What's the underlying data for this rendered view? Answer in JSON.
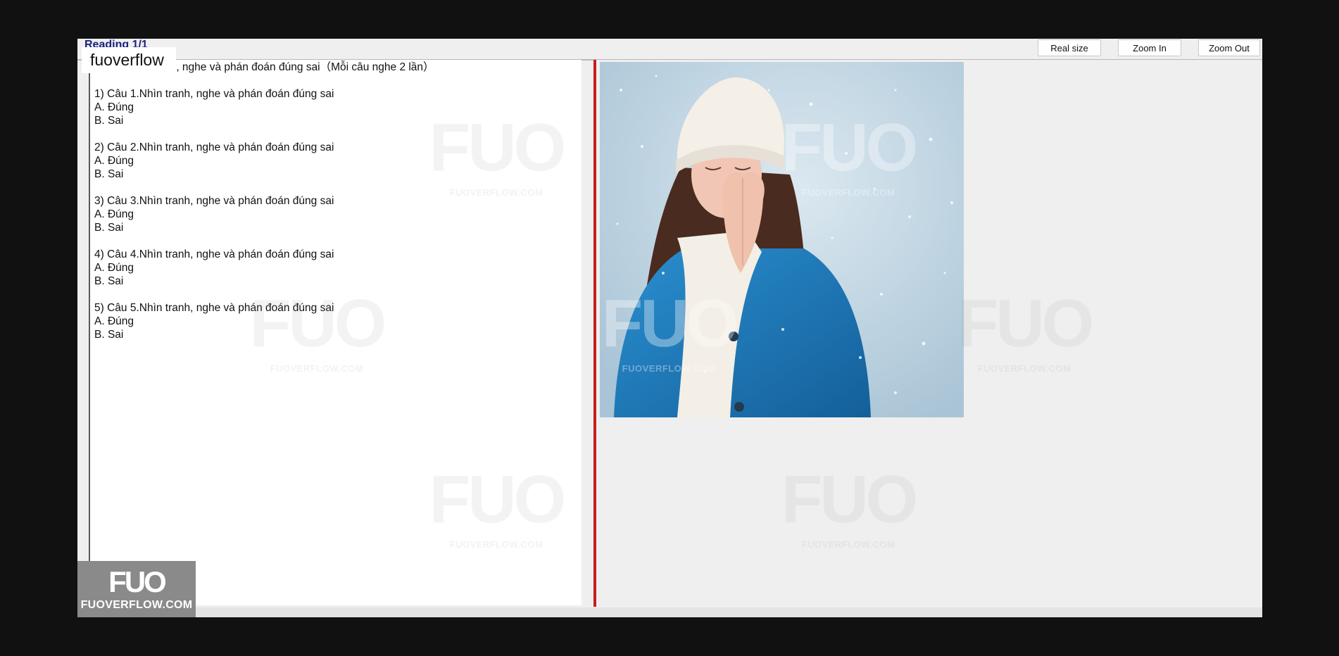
{
  "app": {
    "title": "Reading 1/1"
  },
  "toolbar": {
    "real_size": "Real size",
    "zoom_in": "Zoom In",
    "zoom_out": "Zoom Out"
  },
  "watermark": {
    "corner_label": "fuoverflow",
    "logo": "FUO",
    "site": "FUOVERFLOW.COM"
  },
  "question_panel": {
    "heading": "Bài 1. Nhìn tranh, nghe và phán đoán đúng sai（Mỗi câu nghe 2 lần）",
    "questions": [
      {
        "prompt": "1) Câu 1.Nhìn tranh, nghe và phán đoán đúng sai",
        "option_a": "A.  Đúng",
        "option_b": "B.  Sai"
      },
      {
        "prompt": "2) Câu 2.Nhìn tranh, nghe và phán đoán đúng sai",
        "option_a": "A.  Đúng",
        "option_b": "B.  Sai"
      },
      {
        "prompt": "3) Câu 3.Nhìn tranh, nghe và phán đoán đúng sai",
        "option_a": "A.  Đúng",
        "option_b": "B.  Sai"
      },
      {
        "prompt": "4) Câu 4.Nhìn tranh, nghe và phán đoán đúng sai",
        "option_a": "A.  Đúng",
        "option_b": "B.  Sai"
      },
      {
        "prompt": "5) Câu 5.Nhìn tranh, nghe và phán đoán đúng sai",
        "option_a": "A.  Đúng",
        "option_b": "B.  Sai"
      }
    ]
  },
  "colors": {
    "splitter": "#c41e1e",
    "coat": "#1f7fbf",
    "sky": "#c9dbe6"
  },
  "icons": {
    "photo": "woman-in-snow-image"
  }
}
